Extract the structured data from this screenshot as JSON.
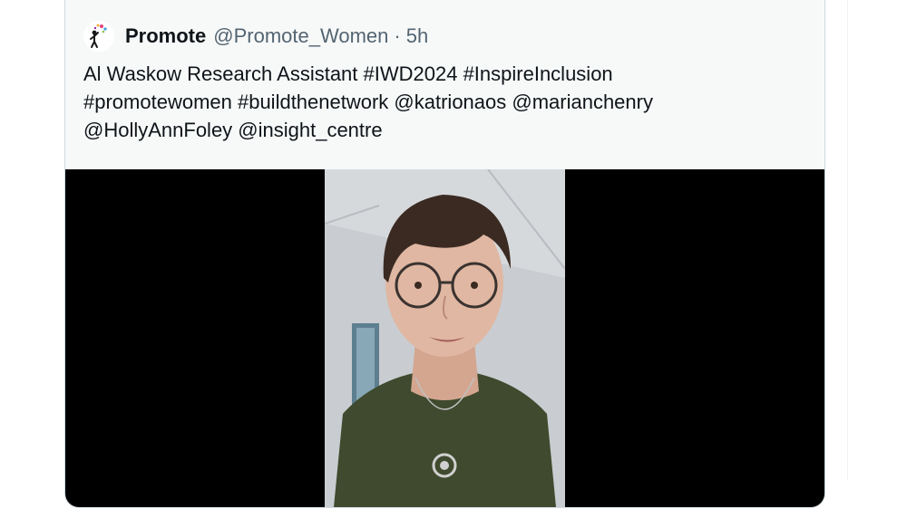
{
  "tweet": {
    "display_name": "Promote",
    "handle": "@Promote_Women",
    "separator": "·",
    "time": "5h",
    "text": "Al Waskow Research Assistant #IWD2024 #InspireInclusion\n#promotewomen #buildthenetwork @katrionaos @marianchenry\n@HollyAnnFoley @insight_centre"
  },
  "media": {
    "type": "video",
    "description_icon": "video-thumbnail"
  },
  "colors": {
    "card_bg": "#f7f9f9",
    "border": "#cfd9de",
    "text_primary": "#0f1419",
    "text_secondary": "#536471",
    "media_bg": "#000000"
  }
}
